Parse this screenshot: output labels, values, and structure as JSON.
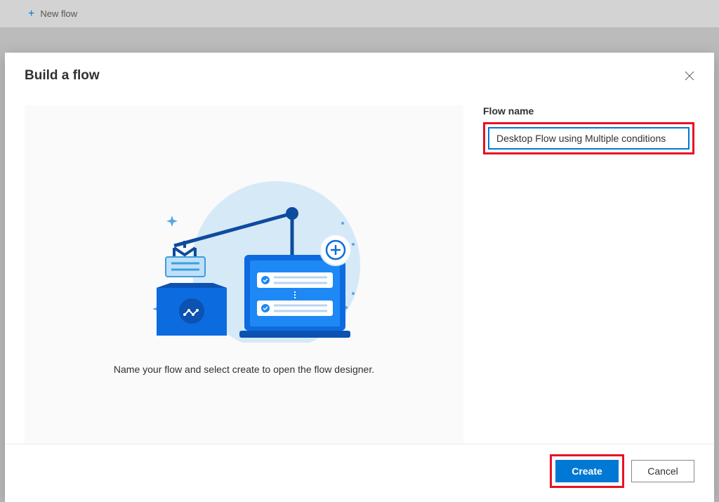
{
  "toolbar": {
    "new_flow_label": "New flow"
  },
  "modal": {
    "title": "Build a flow",
    "helper_text": "Name your flow and select create to open the flow designer.",
    "field_label": "Flow name",
    "flow_name_value": "Desktop Flow using Multiple conditions",
    "create_label": "Create",
    "cancel_label": "Cancel"
  }
}
